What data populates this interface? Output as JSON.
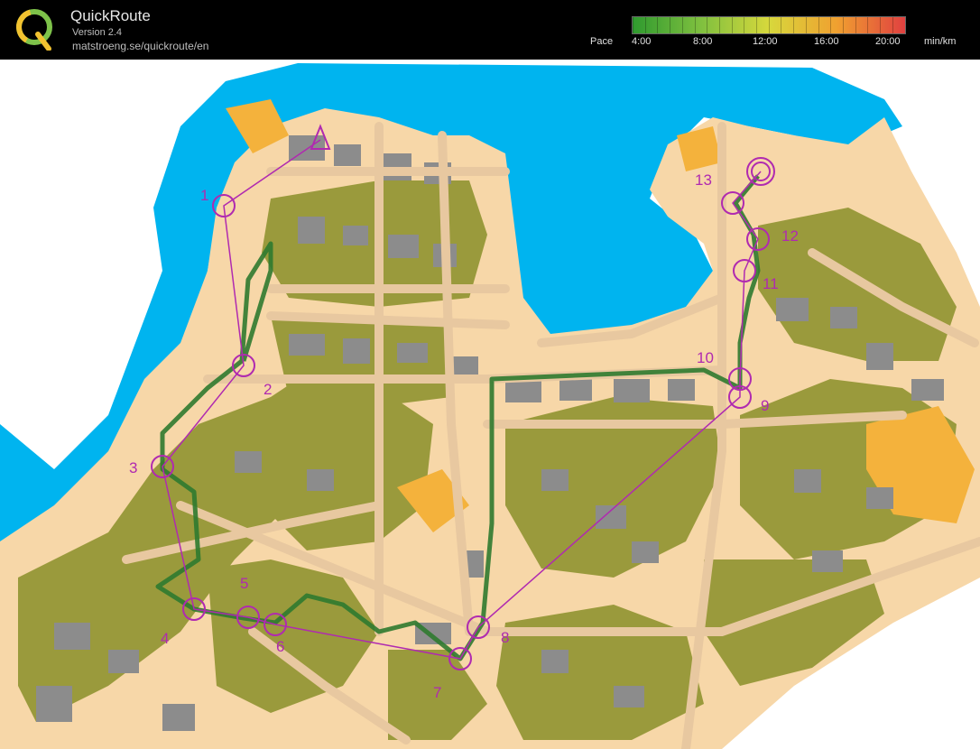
{
  "app": {
    "title": "QuickRoute",
    "version": "Version 2.4",
    "url": "matstroeng.se/quickroute/en"
  },
  "pace_scale": {
    "label": "Pace",
    "ticks": [
      "4:00",
      "8:00",
      "12:00",
      "16:00",
      "20:00"
    ],
    "unit": "min/km",
    "colors": [
      "#2f9a2f",
      "#7fc03f",
      "#d7d83c",
      "#f0a030",
      "#e04040"
    ]
  },
  "map": {
    "controls": [
      {
        "label": "1"
      },
      {
        "label": "2"
      },
      {
        "label": "3"
      },
      {
        "label": "4"
      },
      {
        "label": "5"
      },
      {
        "label": "6"
      },
      {
        "label": "7"
      },
      {
        "label": "8"
      },
      {
        "label": "9"
      },
      {
        "label": "10"
      },
      {
        "label": "11"
      },
      {
        "label": "12"
      },
      {
        "label": "13"
      }
    ],
    "colors": {
      "water": "#00b4ef",
      "land": "#f7d7a8",
      "vegetation": "#9a9a3c",
      "open_land": "#f4b23c",
      "building": "#8c8c8c",
      "road": "#e8c8a0",
      "course": "#b02ab0",
      "route": "#2f7a2f"
    }
  }
}
